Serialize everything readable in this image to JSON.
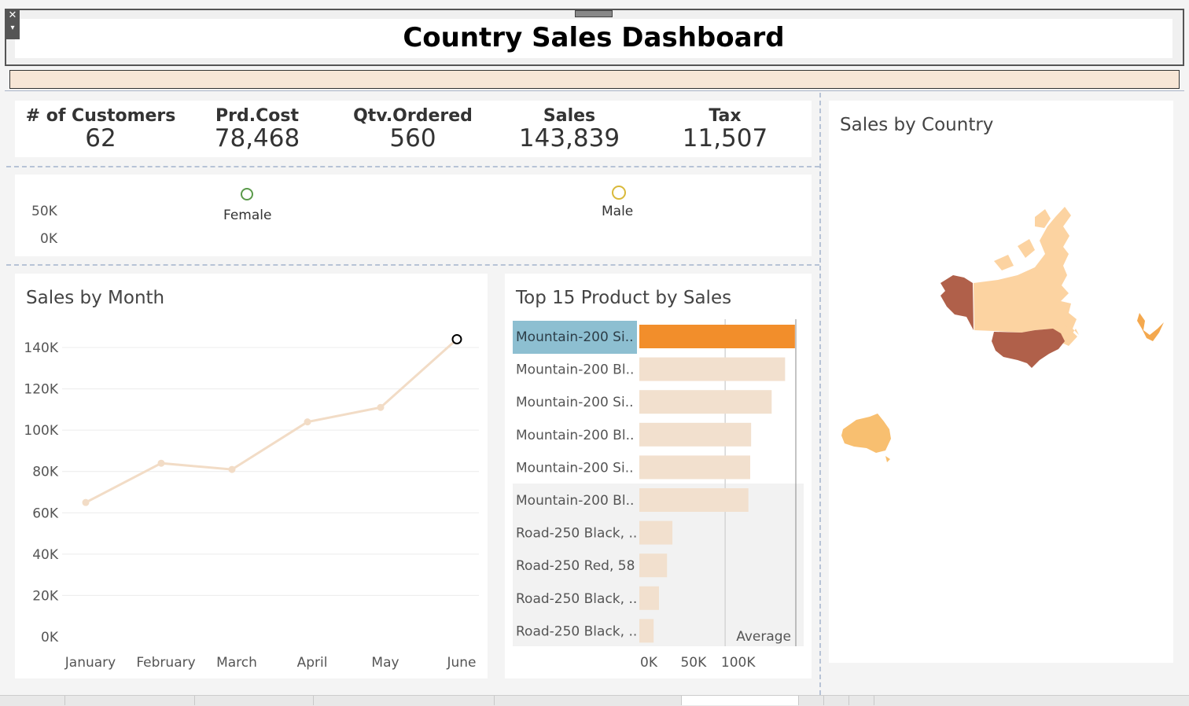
{
  "dashboard": {
    "title": "Country Sales Dashboard",
    "close_glyph": "✕",
    "menu_glyph": "▾"
  },
  "kpis": [
    {
      "label": "# of Customers",
      "value": "62"
    },
    {
      "label": "Prd.Cost",
      "value": "78,468"
    },
    {
      "label": "Qtv.Ordered",
      "value": "560"
    },
    {
      "label": "Sales",
      "value": "143,839"
    },
    {
      "label": "Tax",
      "value": "11,507"
    }
  ],
  "gender": {
    "axis": [
      "50K",
      "0K"
    ],
    "female_label": "Female",
    "male_label": "Male",
    "female_color": "#5a9a4a",
    "male_color": "#d9b93a"
  },
  "sales_by_month": {
    "title": "Sales by Month",
    "chart_data": {
      "type": "line",
      "categories": [
        "January",
        "February",
        "March",
        "April",
        "May",
        "June"
      ],
      "values": [
        65000,
        84000,
        81000,
        104000,
        111000,
        144000
      ],
      "ylim": [
        0,
        150000
      ],
      "yticks": [
        "140K",
        "120K",
        "100K",
        "80K",
        "60K",
        "40K",
        "20K",
        "0K"
      ],
      "ytick_values": [
        140000,
        120000,
        100000,
        80000,
        60000,
        40000,
        20000,
        0
      ],
      "color": "#f2dcc6",
      "highlight_color": "#000000",
      "grid": true
    }
  },
  "top_products": {
    "title": "Top 15 Product by Sales",
    "chart_data": {
      "type": "bar",
      "orientation": "horizontal",
      "categories": [
        "Mountain-200 Si..",
        "Mountain-200 Bl..",
        "Mountain-200 Si..",
        "Mountain-200 Bl..",
        "Mountain-200 Si..",
        "Mountain-200 Bl..",
        "Road-250 Black, ..",
        "Road-250 Red, 58",
        "Road-250 Black, ..",
        "Road-250 Black, .."
      ],
      "values": [
        174000,
        163000,
        148000,
        125000,
        124000,
        122000,
        37000,
        31000,
        22000,
        16000
      ],
      "xticks": [
        "0K",
        "50K",
        "100K"
      ],
      "xtick_values": [
        0,
        50000,
        100000
      ],
      "xlim": [
        0,
        175000
      ],
      "reference_line": {
        "label": "Average",
        "value": 96000
      },
      "highlight_color": "#f28e2b",
      "highlight_label_bg": "#8dbfd1",
      "bar_color": "#f2e0ce"
    }
  },
  "sales_by_country": {
    "title": "Sales by Country",
    "colors": {
      "usa": "#b0604a",
      "alaska": "#b0604a",
      "canada": "#fcd3a1",
      "australia": "#f8bf70",
      "uk": "#f4a84e"
    }
  }
}
